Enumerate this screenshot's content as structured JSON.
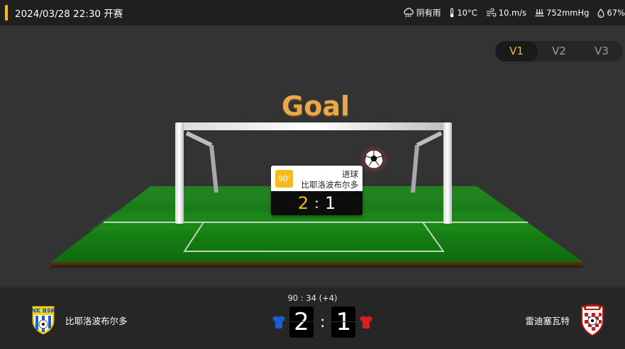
{
  "header": {
    "match_time": "2024/03/28 22:30 开赛",
    "accent_color": "#f6b91e",
    "weather": [
      {
        "icon": "cloud-rain-icon",
        "text": "阴有雨"
      },
      {
        "icon": "thermometer-icon",
        "text": "10°C"
      },
      {
        "icon": "wind-icon",
        "text": "10.m/s"
      },
      {
        "icon": "pressure-icon",
        "text": "752mmHg"
      },
      {
        "icon": "humidity-icon",
        "text": "67%"
      }
    ]
  },
  "versions": [
    "V1",
    "V2",
    "V3"
  ],
  "active_version": "V1",
  "scene": {
    "title": "Goal",
    "event": {
      "minute": "90'",
      "type": "进球",
      "team": "比耶洛波布尔多",
      "home_score": "2",
      "away_score": "1",
      "separator": ":"
    }
  },
  "match": {
    "clock": "90 : 34  (+4)",
    "home": {
      "name": "比耶洛波布尔多",
      "score": "2",
      "shirt_color": "#1a5fd0",
      "logo": "nk-bsk-crest"
    },
    "away": {
      "name": "雷迪塞瓦特",
      "score": "1",
      "shirt_color": "#d42020",
      "logo": "checkered-crest"
    },
    "separator": ":"
  }
}
